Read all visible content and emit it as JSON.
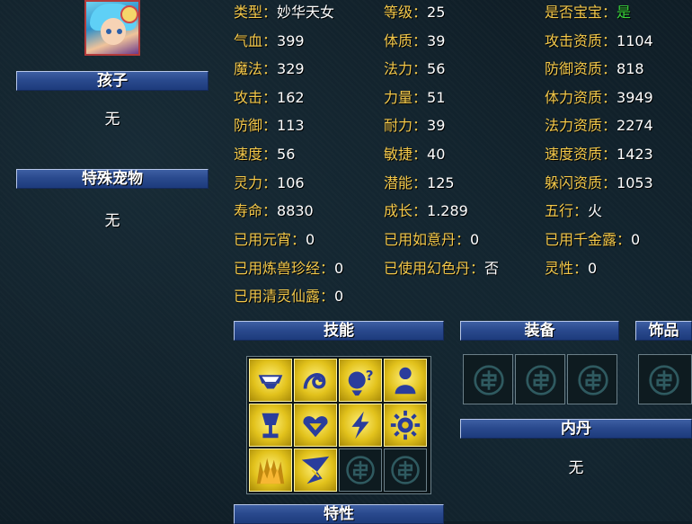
{
  "child": {
    "title": "孩子",
    "value": "无"
  },
  "special_pet": {
    "title": "特殊宠物",
    "value": "无"
  },
  "stats": {
    "type": {
      "label": "类型：",
      "value": "妙华天女"
    },
    "level": {
      "label": "等级：",
      "value": "25"
    },
    "is_baby": {
      "label": "是否宝宝：",
      "value": "是"
    },
    "hp": {
      "label": "气血：",
      "value": "399"
    },
    "constitution": {
      "label": "体质：",
      "value": "39"
    },
    "attack_apt": {
      "label": "攻击资质：",
      "value": "1104"
    },
    "mp": {
      "label": "魔法：",
      "value": "329"
    },
    "magic": {
      "label": "法力：",
      "value": "56"
    },
    "defense_apt": {
      "label": "防御资质：",
      "value": "818"
    },
    "attack": {
      "label": "攻击：",
      "value": "162"
    },
    "strength": {
      "label": "力量：",
      "value": "51"
    },
    "stamina_apt": {
      "label": "体力资质：",
      "value": "3949"
    },
    "defense": {
      "label": "防御：",
      "value": "113"
    },
    "endurance": {
      "label": "耐力：",
      "value": "39"
    },
    "magic_apt": {
      "label": "法力资质：",
      "value": "2274"
    },
    "speed": {
      "label": "速度：",
      "value": "56"
    },
    "agility": {
      "label": "敏捷：",
      "value": "40"
    },
    "speed_apt": {
      "label": "速度资质：",
      "value": "1423"
    },
    "spirit": {
      "label": "灵力：",
      "value": "106"
    },
    "potential": {
      "label": "潜能：",
      "value": "125"
    },
    "dodge_apt": {
      "label": "躲闪资质：",
      "value": "1053"
    },
    "lifespan": {
      "label": "寿命：",
      "value": "8830"
    },
    "growth": {
      "label": "成长：",
      "value": "1.289"
    },
    "element": {
      "label": "五行：",
      "value": "火"
    },
    "yuanxiao": {
      "label": "已用元宵：",
      "value": "0"
    },
    "ruyidan": {
      "label": "已用如意丹：",
      "value": "0"
    },
    "qianjinlu": {
      "label": "已用千金露：",
      "value": "0"
    },
    "lianshou": {
      "label": "已用炼兽珍经：",
      "value": "0"
    },
    "huanse": {
      "label": "已使用幻色丹：",
      "value": "否"
    },
    "lingxing": {
      "label": "灵性：",
      "value": "0"
    },
    "qingling": {
      "label": "已用清灵仙露：",
      "value": "0"
    }
  },
  "sections": {
    "skills": "技能",
    "equipment": "装备",
    "accessory": "饰品",
    "neidan": "内丹",
    "neidan_value": "无",
    "traits": "特性"
  },
  "skill_icons": [
    "roar-mouth-icon",
    "swirling-spirit-icon",
    "question-orb-icon",
    "silhouette-icon",
    "goblet-icon",
    "heart-shield-icon",
    "lightning-icon",
    "sun-gear-icon",
    "flame-wall-icon",
    "blade-strike-icon",
    "empty-slot-icon",
    "empty-slot-icon"
  ],
  "colors": {
    "label": "#f3c84a",
    "value": "#ffffff",
    "yes": "#39d43a",
    "bar": "#2a4a8e"
  }
}
